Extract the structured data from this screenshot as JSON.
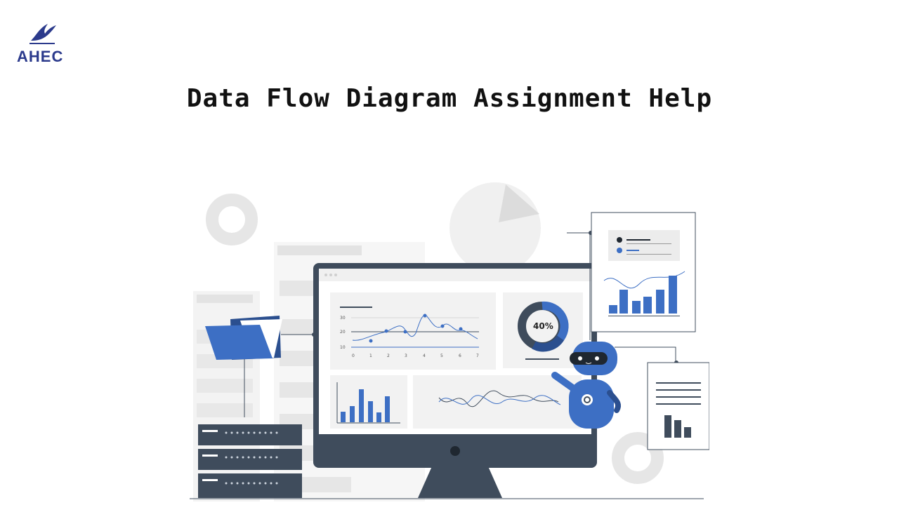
{
  "brand": {
    "logo_text": "AHEC",
    "logo_icon": "swallow-bird-icon",
    "color": "#2b3a8c"
  },
  "page": {
    "title": "Data Flow Diagram Assignment Help"
  },
  "illustration": {
    "donut_percent_label": "40%",
    "line_chart_y_ticks": [
      "30",
      "20",
      "10"
    ],
    "line_chart_x_ticks": [
      "0",
      "1",
      "2",
      "3",
      "4",
      "5",
      "6",
      "7"
    ],
    "accent_color": "#3d6fc4",
    "dark_color": "#3f4c5c"
  }
}
